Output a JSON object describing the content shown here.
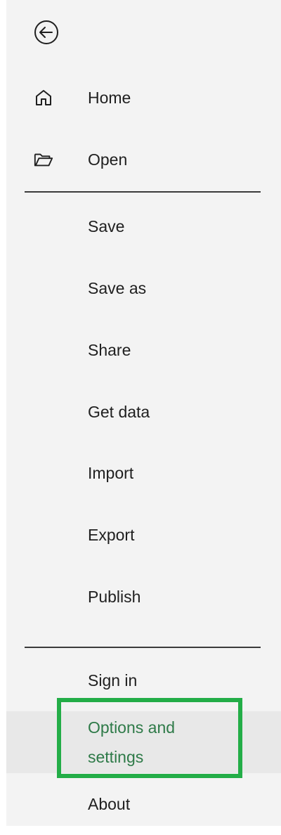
{
  "nav": {
    "back_icon": "back-arrow-icon",
    "primary": [
      {
        "label": "Home",
        "icon": "home-icon"
      },
      {
        "label": "Open",
        "icon": "folder-open-icon"
      }
    ],
    "file_actions": [
      {
        "label": "Save"
      },
      {
        "label": "Save as"
      },
      {
        "label": "Share"
      },
      {
        "label": "Get data"
      },
      {
        "label": "Import"
      },
      {
        "label": "Export"
      },
      {
        "label": "Publish"
      }
    ],
    "footer": [
      {
        "label": "Sign in"
      },
      {
        "label": "Options and settings",
        "selected": true
      },
      {
        "label": "About"
      }
    ]
  },
  "colors": {
    "pane_background": "#f3f3f3",
    "selected_background": "#e8e8e8",
    "selected_text": "#2e7a48",
    "highlight_border": "#23ad47",
    "text": "#1f1f1f"
  }
}
